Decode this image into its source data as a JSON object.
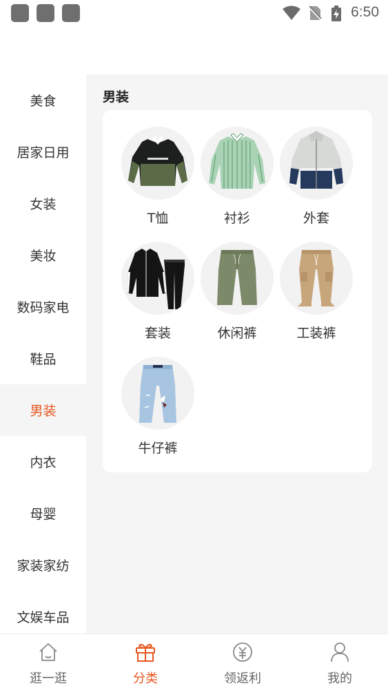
{
  "status_bar": {
    "time": "6:50"
  },
  "sidebar": {
    "items": [
      {
        "label": "美食"
      },
      {
        "label": "居家日用"
      },
      {
        "label": "女装"
      },
      {
        "label": "美妆"
      },
      {
        "label": "数码家电"
      },
      {
        "label": "鞋品"
      },
      {
        "label": "男装"
      },
      {
        "label": "内衣"
      },
      {
        "label": "母婴"
      },
      {
        "label": "家装家纺"
      },
      {
        "label": "文娱车品"
      }
    ],
    "active_index": 6
  },
  "main": {
    "category_title": "男装",
    "products": [
      {
        "label": "T恤",
        "icon": "sweatshirt-image"
      },
      {
        "label": "衬衫",
        "icon": "shirt-image"
      },
      {
        "label": "外套",
        "icon": "jacket-image"
      },
      {
        "label": "套装",
        "icon": "tracksuit-image"
      },
      {
        "label": "休闲裤",
        "icon": "casual-pants-image"
      },
      {
        "label": "工装裤",
        "icon": "cargo-pants-image"
      },
      {
        "label": "牛仔裤",
        "icon": "jeans-image"
      }
    ]
  },
  "bottom_nav": {
    "items": [
      {
        "label": "逛一逛",
        "icon": "home-icon"
      },
      {
        "label": "分类",
        "icon": "gift-icon"
      },
      {
        "label": "领返利",
        "icon": "rebate-icon"
      },
      {
        "label": "我的",
        "icon": "user-icon"
      }
    ],
    "active_index": 1
  },
  "colors": {
    "accent": "#e8561f",
    "background": "#f5f5f5"
  }
}
